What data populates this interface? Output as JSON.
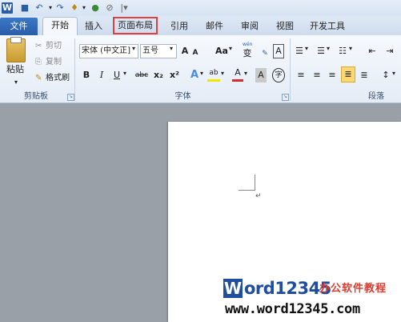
{
  "quick_access": {
    "app_icon": "W",
    "icons": [
      "word-app-icon",
      "save-icon",
      "undo-icon",
      "redo-icon",
      "format-painter-icon",
      "color-icon",
      "clear-icon",
      "customize-icon"
    ]
  },
  "tabs": {
    "file": "文件",
    "items": [
      "开始",
      "插入",
      "页面布局",
      "引用",
      "邮件",
      "审阅",
      "视图",
      "开发工具"
    ],
    "highlighted": "页面布局",
    "highlight_color": "#e0403c"
  },
  "clipboard": {
    "paste": "粘贴",
    "cut": "剪切",
    "copy": "复制",
    "format_painter": "格式刷",
    "group_label": "剪贴板"
  },
  "font": {
    "font_name": "宋体 (中文正]",
    "font_size": "五号",
    "grow": "A",
    "shrink": "A",
    "case": "Aa",
    "phonetic": "wén",
    "phonetic_char": "变",
    "border_char": "A",
    "bold": "B",
    "italic": "I",
    "underline": "U",
    "strike": "abc",
    "subscript": "x₂",
    "superscript": "x²",
    "text_effect": "A",
    "highlight": "ab",
    "font_color": "A",
    "char_shading": "A",
    "enclosed": "字",
    "group_label": "字体"
  },
  "paragraph": {
    "group_label": "段落"
  },
  "document": {
    "paragraph_mark": "↵"
  },
  "watermark": {
    "logo_letter": "W",
    "brand": "ord12345",
    "slogan": "办公软件教程",
    "url": "www.word12345.com"
  }
}
